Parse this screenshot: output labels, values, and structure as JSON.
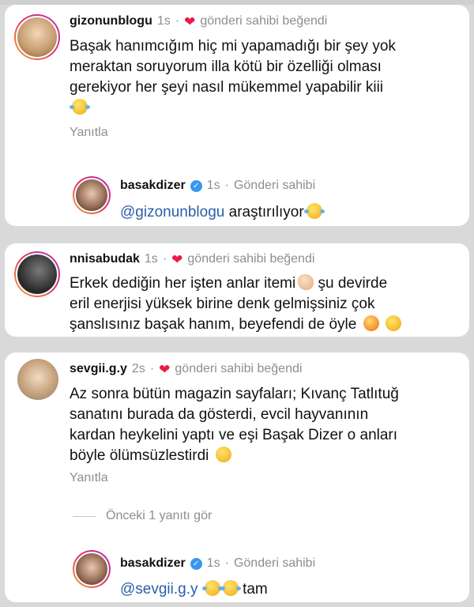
{
  "comments": [
    {
      "username": "gizonunblogu",
      "time": "1s",
      "liked_text": "gönderi sahibi beğendi",
      "lines": [
        "Başak hanımcığım hiç mi yapamadığı bir şey yok",
        "meraktan soruyorum illa kötü bir özelliği olması",
        "gerekiyor her şeyi nasıl mükemmel yapabilir kiii"
      ],
      "reply_label": "Yanıtla",
      "owner_reply": {
        "username": "basakdizer",
        "time": "1s",
        "owner_label": "Gönderi sahibi",
        "mention": "@gizonunblogu",
        "text": "araştırılıyor"
      }
    },
    {
      "username": "nnisabudak",
      "time": "1s",
      "liked_text": "gönderi sahibi beğendi",
      "lines": [
        "Erkek dediğin her işten anlar itemi",
        "şu devirde",
        "eril enerjisi yüksek birine denk gelmişsiniz çok",
        "şanslısınız başak hanım, beyefendi de öyle"
      ]
    },
    {
      "username": "sevgii.g.y",
      "time": "2s",
      "liked_text": "gönderi sahibi beğendi",
      "lines": [
        "Az sonra bütün magazin sayfaları; Kıvanç Tatlıtuğ",
        "sanatını burada da gösterdi, evcil hayvanının",
        "kardan heykelini yaptı ve eşi Başak Dizer o anları",
        "böyle ölümsüzlestirdi"
      ],
      "reply_label": "Yanıtla",
      "view_replies": "Önceki 1 yanıtı gör",
      "owner_reply": {
        "username": "basakdizer",
        "time": "1s",
        "owner_label": "Gönderi sahibi",
        "mention": "@sevgii.g.y",
        "text": "tam"
      }
    }
  ],
  "separator": "·",
  "icons": {
    "heart": "red-heart-icon",
    "verified": "verified-badge-icon"
  },
  "colors": {
    "heart": "#ed1848",
    "mention": "#2b5ea8",
    "verified": "#3897f0",
    "muted": "#8e8e8e"
  }
}
